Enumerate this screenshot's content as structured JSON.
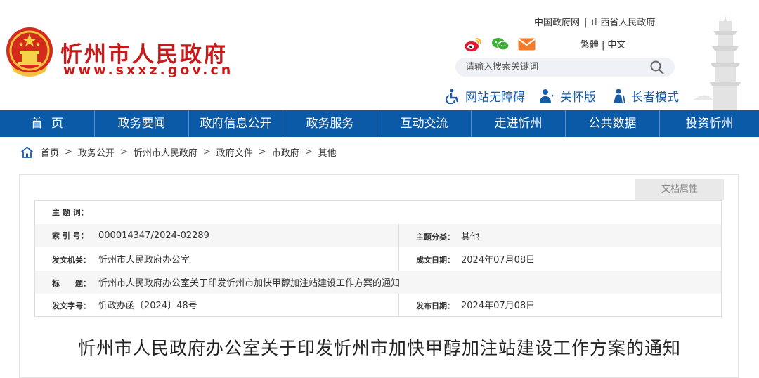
{
  "header": {
    "site_name": "忻州市人民政府",
    "site_url": "www.sxxz.gov.cn",
    "top_links": [
      "中国政府网",
      "山西省人民政府"
    ],
    "lang": [
      "繁體",
      "中文"
    ],
    "social_icons": [
      "weibo-icon",
      "wechat-icon",
      "email-icon"
    ],
    "search_placeholder": "请输入搜索关键词",
    "access": {
      "barrier_free": "网站无障碍",
      "care_mode": "关怀版",
      "elder_mode": "长者模式"
    },
    "colors": {
      "brand_red": "#c81a1a",
      "nav_blue": "#0b5aa8",
      "access_blue": "#1a5ba8"
    }
  },
  "nav": [
    "首页",
    "政务要闻",
    "政府信息公开",
    "政务服务",
    "互动交流",
    "走进忻州",
    "公共数据",
    "投资忻州"
  ],
  "breadcrumb": [
    "首页",
    "政务公开",
    "忻州市人民政府",
    "政府文件",
    "市政府",
    "其他"
  ],
  "doc_attrs": {
    "tab_label": "文档属性",
    "subject_label": "主 题 词：",
    "subject_value": "",
    "index_label": "索 引 号：",
    "index_value": "000014347/2024-02289",
    "category_label": "主题分类：",
    "category_value": "其他",
    "issuer_label": "发文机关：",
    "issuer_value": "忻州市人民政府办公室",
    "created_label": "成文日期：",
    "created_value": "2024年07月08日",
    "title_label": "标　　题：",
    "title_value": "忻州市人民政府办公室关于印发忻州市加快甲醇加注站建设工作方案的通知",
    "docno_label": "发文字号：",
    "docno_value": "忻政办函〔2024〕48号",
    "published_label": "发布日期：",
    "published_value": "2024年07月08日"
  },
  "doc_title": "忻州市人民政府办公室关于印发忻州市加快甲醇加注站建设工作方案的通知"
}
